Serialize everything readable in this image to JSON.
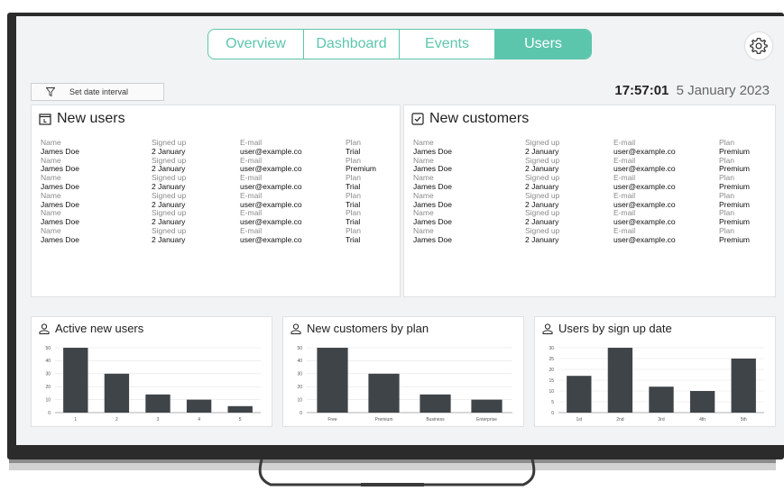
{
  "tabs": [
    {
      "label": "Overview",
      "active": false
    },
    {
      "label": "Dashboard",
      "active": false
    },
    {
      "label": "Events",
      "active": false
    },
    {
      "label": "Users",
      "active": true
    }
  ],
  "colors": {
    "accent": "#5cc6ad",
    "bar": "#3f4448",
    "bezel": "#2b2b2b"
  },
  "date_filter": {
    "label": "Set date interval",
    "icon": "filter-icon"
  },
  "clock": {
    "time": "17:57:01",
    "date": "5 January 2023"
  },
  "settings": {
    "icon": "gear-icon"
  },
  "new_users": {
    "title": "New users",
    "icon": "calendar-icon",
    "headers": [
      "Name",
      "Signed up",
      "E-mail",
      "Plan"
    ],
    "rows": [
      [
        "James Doe",
        "2 January",
        "user@example.co",
        "Trial"
      ],
      [
        "James Doe",
        "2 January",
        "user@example.co",
        "Premium"
      ],
      [
        "James Doe",
        "2 January",
        "user@example.co",
        "Trial"
      ],
      [
        "James Doe",
        "2 January",
        "user@example.co",
        "Trial"
      ],
      [
        "James Doe",
        "2 January",
        "user@example.co",
        "Trial"
      ],
      [
        "James Doe",
        "2 January",
        "user@example.co",
        "Trial"
      ]
    ]
  },
  "new_customers": {
    "title": "New customers",
    "icon": "checkbox-icon",
    "headers": [
      "Name",
      "Signed up",
      "E-mail",
      "Plan"
    ],
    "rows": [
      [
        "James Doe",
        "2 January",
        "user@example.co",
        "Premium"
      ],
      [
        "James Doe",
        "2 January",
        "user@example.co",
        "Premium"
      ],
      [
        "James Doe",
        "2 January",
        "user@example.co",
        "Premium"
      ],
      [
        "James Doe",
        "2 January",
        "user@example.co",
        "Premium"
      ],
      [
        "James Doe",
        "2 January",
        "user@example.co",
        "Premium"
      ],
      [
        "James Doe",
        "2 January",
        "user@example.co",
        "Premium"
      ]
    ]
  },
  "chart_data": [
    {
      "type": "bar",
      "title": "Active new users",
      "icon": "user-icon",
      "categories": [
        "1",
        "2",
        "3",
        "4",
        "5"
      ],
      "values": [
        50,
        30,
        14,
        10,
        5
      ],
      "ylim": [
        0,
        50
      ],
      "yticks": [
        0,
        10,
        20,
        30,
        40,
        50
      ],
      "grid": true
    },
    {
      "type": "bar",
      "title": "New customers by plan",
      "icon": "user-icon",
      "categories": [
        "Free",
        "Premium",
        "Business",
        "Enterprise"
      ],
      "values": [
        50,
        30,
        14,
        10
      ],
      "ylim": [
        0,
        50
      ],
      "yticks": [
        0,
        10,
        20,
        30,
        40,
        50
      ],
      "grid": true
    },
    {
      "type": "bar",
      "title": "Users by sign up date",
      "icon": "user-icon",
      "categories": [
        "1st",
        "2nd",
        "3rd",
        "4th",
        "5th"
      ],
      "values": [
        17,
        30,
        12,
        10,
        25
      ],
      "ylim": [
        0,
        30
      ],
      "yticks": [
        0,
        5,
        10,
        15,
        20,
        25,
        30
      ],
      "grid": true
    }
  ]
}
